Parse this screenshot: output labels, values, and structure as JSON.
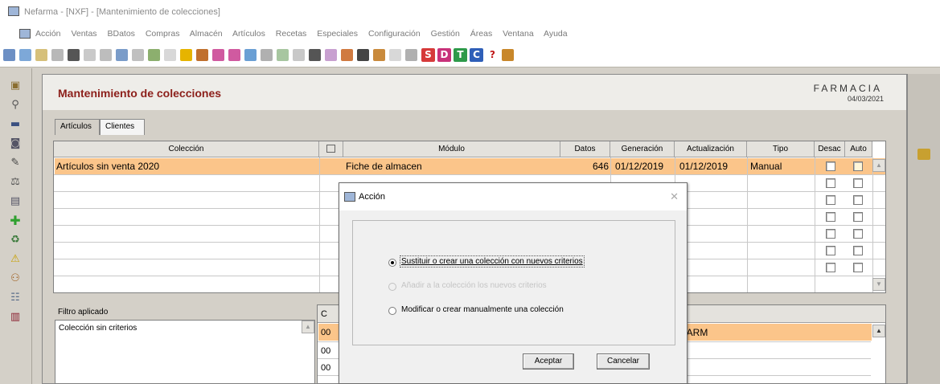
{
  "window": {
    "title": "Nefarma - [NXF] - [Mantenimiento de colecciones]"
  },
  "menu": [
    "Acción",
    "Ventas",
    "BDatos",
    "Compras",
    "Almacén",
    "Artículos",
    "Recetas",
    "Especiales",
    "Configuración",
    "Gestión",
    "Áreas",
    "Ventana",
    "Ayuda"
  ],
  "toolbar_letters": {
    "s": "S",
    "d": "D",
    "t": "T",
    "c": "C",
    "help": "?"
  },
  "header": {
    "title": "Mantenimiento de colecciones",
    "brand": "FARMACIA",
    "date": "04/03/2021"
  },
  "tabs": {
    "articulos": "Artículos",
    "clientes": "Clientes"
  },
  "grid": {
    "columns": {
      "coleccion": "Colección",
      "modulo": "Módulo",
      "datos": "Datos",
      "generacion": "Generación",
      "actualizacion": "Actualización",
      "tipo": "Tipo",
      "desac": "Desac",
      "auto": "Auto"
    },
    "rows": [
      {
        "coleccion": "Artículos sin venta 2020",
        "modulo": "Fiche de almacen",
        "datos": "646",
        "generacion": "01/12/2019",
        "actualizacion": "01/12/2019",
        "tipo": "Manual"
      }
    ]
  },
  "filter": {
    "label": "Filtro aplicado",
    "text": "Colección sin criterios"
  },
  "grid2": {
    "col_header": "C",
    "row1_code": "00",
    "row2_code": "00",
    "row3_code": "00",
    "row1_value": "COFARM"
  },
  "dialog": {
    "title": "Acción",
    "options": [
      {
        "label": "Sustituir o crear una colección con nuevos criterios",
        "selected": true,
        "enabled": true
      },
      {
        "label": "Añadir a la colección los nuevos criterios",
        "selected": false,
        "enabled": false
      },
      {
        "label": "Modificar o crear manualmente una colección",
        "selected": false,
        "enabled": true
      }
    ],
    "ok": "Aceptar",
    "cancel": "Cancelar"
  },
  "colors": {
    "selected_row": "#fbc58a",
    "title": "#8c1f1a"
  }
}
